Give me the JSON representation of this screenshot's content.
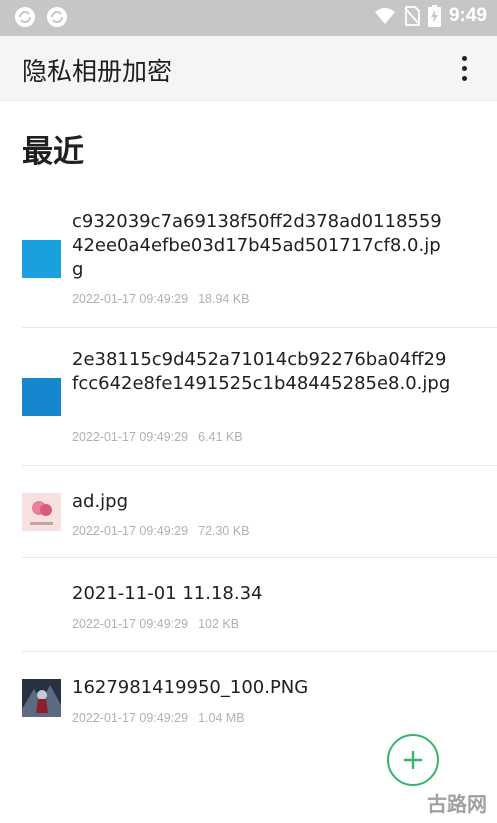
{
  "status_bar": {
    "time": "9:49",
    "icons": [
      "sync-icon",
      "sync-icon",
      "wifi-icon",
      "no-sim-icon",
      "battery-charging-icon"
    ]
  },
  "app_bar": {
    "title": "隐私相册加密",
    "menu_icon": "more-vert-icon"
  },
  "section": {
    "title": "最近"
  },
  "files": [
    {
      "name": "c932039c7a69138f50ff2d378ad011855942ee0a4efbe03d17b45ad501717cf8.0.jpg",
      "date": "2022-01-17 09:49:29",
      "size": "18.94 KB",
      "thumb": "blue-square",
      "thumb_color": "#1aa0dc"
    },
    {
      "name": "2e38115c9d452a71014cb92276ba04ff29fcc642e8fe1491525c1b48445285e8.0.jpg",
      "date": "2022-01-17 09:49:29",
      "size": "6.41 KB",
      "thumb": "blue-square",
      "thumb_color": "#1686cf"
    },
    {
      "name": "ad.jpg",
      "date": "2022-01-17 09:49:29",
      "size": "72.30 KB",
      "thumb": "pink-ad-image"
    },
    {
      "name": "2021-11-01 11.18.34",
      "date": "2022-01-17 09:49:29",
      "size": "102 KB",
      "thumb": "none"
    },
    {
      "name": "1627981419950_100.PNG",
      "date": "2022-01-17 09:49:29",
      "size": "1.04 MB",
      "thumb": "dark-game-image"
    }
  ],
  "fab": {
    "icon": "plus-icon",
    "color": "#37b36a"
  },
  "watermark": "古路网"
}
